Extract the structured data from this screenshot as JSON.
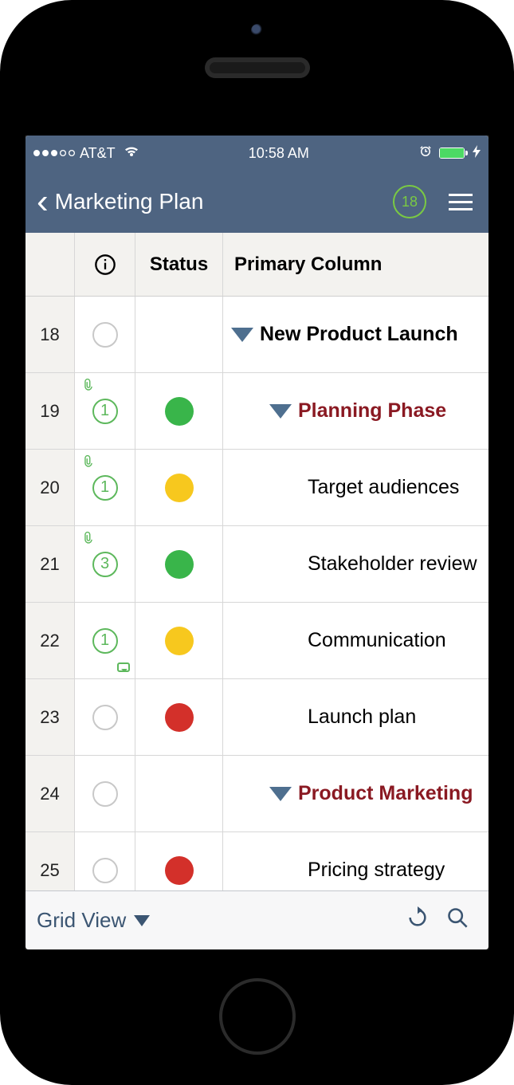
{
  "statusbar": {
    "carrier": "AT&T",
    "time": "10:58 AM"
  },
  "nav": {
    "title": "Marketing Plan",
    "badge": "18"
  },
  "columns": {
    "status": "Status",
    "primary": "Primary Column"
  },
  "status_colors": {
    "green": "#39b54a",
    "yellow": "#f7c81e",
    "red": "#d3302a"
  },
  "rows": [
    {
      "num": "18",
      "attach": false,
      "attCount": "",
      "comment": false,
      "status": "",
      "indent": 0,
      "expand": true,
      "bold": true,
      "section": false,
      "text": "New Product Launch"
    },
    {
      "num": "19",
      "attach": true,
      "attCount": "1",
      "comment": false,
      "status": "green",
      "indent": 1,
      "expand": true,
      "bold": true,
      "section": true,
      "text": "Planning Phase"
    },
    {
      "num": "20",
      "attach": true,
      "attCount": "1",
      "comment": false,
      "status": "yellow",
      "indent": 2,
      "expand": false,
      "bold": false,
      "section": false,
      "text": "Target audiences"
    },
    {
      "num": "21",
      "attach": true,
      "attCount": "3",
      "comment": false,
      "status": "green",
      "indent": 2,
      "expand": false,
      "bold": false,
      "section": false,
      "text": "Stakeholder review"
    },
    {
      "num": "22",
      "attach": false,
      "attCount": "1",
      "comment": true,
      "status": "yellow",
      "indent": 2,
      "expand": false,
      "bold": false,
      "section": false,
      "text": "Communication"
    },
    {
      "num": "23",
      "attach": false,
      "attCount": "",
      "comment": false,
      "status": "red",
      "indent": 2,
      "expand": false,
      "bold": false,
      "section": false,
      "text": "Launch plan"
    },
    {
      "num": "24",
      "attach": false,
      "attCount": "",
      "comment": false,
      "status": "",
      "indent": 1,
      "expand": true,
      "bold": true,
      "section": true,
      "text": "Product Marketing"
    },
    {
      "num": "25",
      "attach": false,
      "attCount": "",
      "comment": false,
      "status": "red",
      "indent": 2,
      "expand": false,
      "bold": false,
      "section": false,
      "text": "Pricing strategy"
    }
  ],
  "toolbar": {
    "view": "Grid View"
  }
}
